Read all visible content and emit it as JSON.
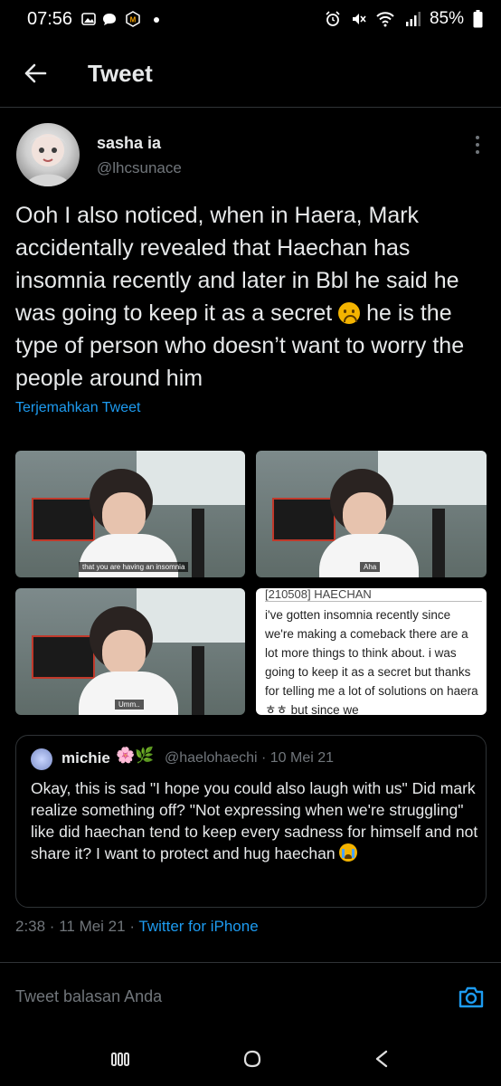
{
  "status_bar": {
    "time": "07:56",
    "battery": "85%",
    "icons_left": [
      "gallery-icon",
      "chat-bubble-icon",
      "app-badge-icon",
      "dot-icon"
    ],
    "icons_right": [
      "alarm-icon",
      "mute-icon",
      "wifi-icon",
      "signal-icon",
      "battery-icon"
    ]
  },
  "header": {
    "title": "Tweet"
  },
  "tweet": {
    "display_name": "sasha ia",
    "handle": "@lhcsunace",
    "text_part1": "Ooh I also noticed, when in Haera, Mark accidentally revealed that Haechan has insomnia recently and later in Bbl he said he was going to keep it as a secret ",
    "text_part2": " he is the type of person who doesn’t want to worry the people around him",
    "translate_label": "Terjemahkan Tweet",
    "media": {
      "caption1": "that you are having an insomnia",
      "caption2": "Aha",
      "caption3": "Umm..",
      "screenshot_header": "[210508] HAECHAN",
      "screenshot_text": "i've gotten insomnia recently since we're making a comeback there are a lot more things to think about. i was going to keep it as a secret but thanks for telling me a lot of solutions on haera ㅎㅎ but since we"
    },
    "timestamp": "2:38 · 11 Mei 21 · ",
    "client": "Twitter for iPhone"
  },
  "quoted_tweet": {
    "display_name": "michie",
    "emojis": "🌸🌿",
    "meta": "@haelohaechi · 10 Mei 21",
    "text": "Okay, this is sad \"I hope you could also laugh with us\" Did mark realize something off? \"Not expressing when we're struggling\" like did haechan tend to keep every sadness for himself and not share it? I want to protect and hug haechan "
  },
  "reply": {
    "placeholder": "Tweet balasan Anda"
  },
  "colors": {
    "background": "#000000",
    "text": "#e7e9ea",
    "muted": "#71767b",
    "accent": "#1d9bf0",
    "divider": "#2f3336"
  }
}
